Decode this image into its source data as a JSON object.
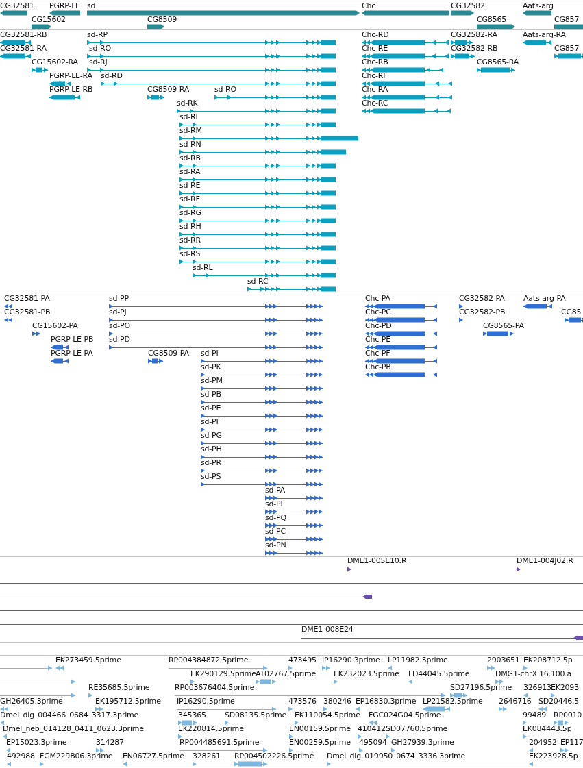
{
  "tracks": [
    {
      "kind": "gene",
      "features": [
        {
          "kind": "labeled",
          "label": "CG32581",
          "reverse": true
        },
        {
          "kind": "labeled",
          "label": "PGRP-LE",
          "reverse": true
        },
        {
          "kind": "labeled",
          "label": "sd",
          "reverse": false
        },
        {
          "kind": "labeled",
          "label": "Chc",
          "reverse": true
        },
        {
          "kind": "labeled",
          "label": "CG32582",
          "reverse": false
        },
        {
          "kind": "labeled",
          "label": "Aats-arg",
          "reverse": true
        },
        {
          "kind": "labeled",
          "label": "CG15602",
          "reverse": false
        },
        {
          "kind": "labeled",
          "label": "CG8509",
          "reverse": false
        },
        {
          "kind": "labeled",
          "label": "CG8565",
          "reverse": false
        },
        {
          "kind": "labeled",
          "label": "CG857",
          "reverse": false
        }
      ]
    },
    {
      "kind": "transcript",
      "features": [
        {
          "kind": "labeled",
          "label": "CG32581-RB",
          "reverse": true
        },
        {
          "kind": "labeled",
          "label": "sd-RP",
          "reverse": false
        },
        {
          "kind": "labeled",
          "label": "Chc-RD",
          "reverse": true
        },
        {
          "kind": "labeled",
          "label": "CG32582-RA",
          "reverse": false
        },
        {
          "kind": "labeled",
          "label": "Aats-arg-RA",
          "reverse": true
        },
        {
          "kind": "labeled",
          "label": "CG32581-RA",
          "reverse": true
        },
        {
          "kind": "labeled",
          "label": "sd-RO",
          "reverse": false
        },
        {
          "kind": "labeled",
          "label": "Chc-RE",
          "reverse": true
        },
        {
          "kind": "labeled",
          "label": "CG32582-RB",
          "reverse": false
        },
        {
          "kind": "labeled",
          "label": "CG857",
          "reverse": false
        },
        {
          "kind": "labeled",
          "label": "CG15602-RA",
          "reverse": false
        },
        {
          "kind": "labeled",
          "label": "sd-RJ",
          "reverse": false
        },
        {
          "kind": "labeled",
          "label": "Chc-RB",
          "reverse": true
        },
        {
          "kind": "labeled",
          "label": "CG8565-RA",
          "reverse": false
        },
        {
          "kind": "labeled",
          "label": "PGRP-LE-RA",
          "reverse": true
        },
        {
          "kind": "labeled",
          "label": "sd-RD",
          "reverse": false
        },
        {
          "kind": "labeled",
          "label": "Chc-RF",
          "reverse": true
        },
        {
          "kind": "labeled",
          "label": "PGRP-LE-RB",
          "reverse": true
        },
        {
          "kind": "labeled",
          "label": "CG8509-RA",
          "reverse": false
        },
        {
          "kind": "labeled",
          "label": "sd-RQ",
          "reverse": false
        },
        {
          "kind": "labeled",
          "label": "Chc-RA",
          "reverse": true
        },
        {
          "kind": "labeled",
          "label": "sd-RK",
          "reverse": false
        },
        {
          "kind": "labeled",
          "label": "Chc-RC",
          "reverse": true
        },
        {
          "kind": "labeled",
          "label": "sd-RI",
          "reverse": false
        },
        {
          "kind": "labeled",
          "label": "sd-RM",
          "reverse": false
        },
        {
          "kind": "labeled",
          "label": "sd-RN",
          "reverse": false
        },
        {
          "kind": "labeled",
          "label": "sd-RB",
          "reverse": false
        },
        {
          "kind": "labeled",
          "label": "sd-RA",
          "reverse": false
        },
        {
          "kind": "labeled",
          "label": "sd-RE",
          "reverse": false
        },
        {
          "kind": "labeled",
          "label": "sd-RF",
          "reverse": false
        },
        {
          "kind": "labeled",
          "label": "sd-RG",
          "reverse": false
        },
        {
          "kind": "labeled",
          "label": "sd-RH",
          "reverse": false
        },
        {
          "kind": "labeled",
          "label": "sd-RR",
          "reverse": false
        },
        {
          "kind": "labeled",
          "label": "sd-RS",
          "reverse": false
        },
        {
          "kind": "labeled",
          "label": "sd-RL",
          "reverse": false
        },
        {
          "kind": "labeled",
          "label": "sd-RC",
          "reverse": false
        }
      ]
    },
    {
      "kind": "protein",
      "features": [
        {
          "kind": "labeled",
          "label": "CG32581-PA",
          "reverse": true
        },
        {
          "kind": "labeled",
          "label": "sd-PP",
          "reverse": false
        },
        {
          "kind": "labeled",
          "label": "Chc-PA",
          "reverse": true
        },
        {
          "kind": "labeled",
          "label": "CG32582-PA",
          "reverse": false
        },
        {
          "kind": "labeled",
          "label": "Aats-arg-PA",
          "reverse": true
        },
        {
          "kind": "labeled",
          "label": "CG32581-PB",
          "reverse": true
        },
        {
          "kind": "labeled",
          "label": "sd-PJ",
          "reverse": false
        },
        {
          "kind": "labeled",
          "label": "Chc-PC",
          "reverse": true
        },
        {
          "kind": "labeled",
          "label": "CG32582-PB",
          "reverse": false
        },
        {
          "kind": "labeled",
          "label": "CG85",
          "reverse": false
        },
        {
          "kind": "labeled",
          "label": "CG15602-PA",
          "reverse": false
        },
        {
          "kind": "labeled",
          "label": "sd-PO",
          "reverse": false
        },
        {
          "kind": "labeled",
          "label": "Chc-PD",
          "reverse": true
        },
        {
          "kind": "labeled",
          "label": "CG8565-PA",
          "reverse": false
        },
        {
          "kind": "labeled",
          "label": "PGRP-LE-PB",
          "reverse": true
        },
        {
          "kind": "labeled",
          "label": "sd-PD",
          "reverse": false
        },
        {
          "kind": "labeled",
          "label": "Chc-PE",
          "reverse": true
        },
        {
          "kind": "labeled",
          "label": "PGRP-LE-PA",
          "reverse": true
        },
        {
          "kind": "labeled",
          "label": "CG8509-PA",
          "reverse": false
        },
        {
          "kind": "labeled",
          "label": "sd-PI",
          "reverse": false
        },
        {
          "kind": "labeled",
          "label": "Chc-PF",
          "reverse": true
        },
        {
          "kind": "labeled",
          "label": "sd-PK",
          "reverse": false
        },
        {
          "kind": "labeled",
          "label": "Chc-PB",
          "reverse": true
        },
        {
          "kind": "labeled",
          "label": "sd-PM",
          "reverse": false
        },
        {
          "kind": "labeled",
          "label": "sd-PB",
          "reverse": false
        },
        {
          "kind": "labeled",
          "label": "sd-PE",
          "reverse": false
        },
        {
          "kind": "labeled",
          "label": "sd-PF",
          "reverse": false
        },
        {
          "kind": "labeled",
          "label": "sd-PG",
          "reverse": false
        },
        {
          "kind": "labeled",
          "label": "sd-PH",
          "reverse": false
        },
        {
          "kind": "labeled",
          "label": "sd-PR",
          "reverse": false
        },
        {
          "kind": "labeled",
          "label": "sd-PS",
          "reverse": false
        },
        {
          "kind": "labeled",
          "label": "sd-PA",
          "reverse": false
        },
        {
          "kind": "labeled",
          "label": "sd-PL",
          "reverse": false
        },
        {
          "kind": "labeled",
          "label": "sd-PQ",
          "reverse": false
        },
        {
          "kind": "labeled",
          "label": "sd-PC",
          "reverse": false
        },
        {
          "kind": "labeled",
          "label": "sd-PN",
          "reverse": false
        }
      ]
    },
    {
      "kind": "alignment",
      "features": [
        {
          "kind": "labeled",
          "label": "DME1-005E10.R",
          "reverse": false
        },
        {
          "kind": "labeled",
          "label": "DME1-004J02.R",
          "reverse": false
        },
        {
          "kind": "unlabeled"
        },
        {
          "kind": "unlabeled",
          "reverse": true
        },
        {
          "kind": "unlabeled"
        },
        {
          "kind": "unlabeled"
        },
        {
          "kind": "labeled",
          "label": "DME1-008E24",
          "reverse": true
        }
      ]
    },
    {
      "kind": "est",
      "features": [
        {
          "kind": "unlabeled",
          "reverse": false
        },
        {
          "kind": "labeled",
          "label": "EK273459.5prime",
          "reverse": true
        },
        {
          "kind": "labeled",
          "label": "RP004384872.5prime",
          "reverse": false
        },
        {
          "kind": "labeled",
          "label": "473495",
          "reverse": false
        },
        {
          "kind": "labeled",
          "label": "IP16290.3prime",
          "reverse": false
        },
        {
          "kind": "labeled",
          "label": "LP11982.5prime",
          "reverse": true
        },
        {
          "kind": "labeled",
          "label": "2903651",
          "reverse": false
        },
        {
          "kind": "labeled",
          "label": "EK208712.5p",
          "reverse": false
        },
        {
          "kind": "unlabeled",
          "reverse": false
        },
        {
          "kind": "labeled",
          "label": "EK290129.5prime",
          "reverse": false
        },
        {
          "kind": "labeled",
          "label": "AT02767.5prime",
          "reverse": false
        },
        {
          "kind": "labeled",
          "label": "EK232023.5prime",
          "reverse": false
        },
        {
          "kind": "labeled",
          "label": "LD44045.5prime",
          "reverse": true
        },
        {
          "kind": "labeled",
          "label": "DMG1-chrX.16.100.a",
          "reverse": false
        },
        {
          "kind": "unlabeled",
          "reverse": false
        },
        {
          "kind": "labeled",
          "label": "RE35685.5prime",
          "reverse": false
        },
        {
          "kind": "labeled",
          "label": "RP003676404.5prime",
          "reverse": false
        },
        {
          "kind": "labeled",
          "label": "SD27196.5prime",
          "reverse": false
        },
        {
          "kind": "labeled",
          "label": "326913",
          "reverse": true
        },
        {
          "kind": "labeled",
          "label": "EK2093",
          "reverse": false
        },
        {
          "kind": "labeled",
          "label": "GH26405.3prime",
          "reverse": true
        },
        {
          "kind": "labeled",
          "label": "EK195712.5prime",
          "reverse": false
        },
        {
          "kind": "labeled",
          "label": "IP16290.5prime",
          "reverse": false
        },
        {
          "kind": "labeled",
          "label": "473576",
          "reverse": false
        },
        {
          "kind": "labeled",
          "label": "380246",
          "reverse": false
        },
        {
          "kind": "labeled",
          "label": "EP16830.3prime",
          "reverse": true
        },
        {
          "kind": "labeled",
          "label": "LP21582.5prime",
          "reverse": true
        },
        {
          "kind": "labeled",
          "label": "2646716",
          "reverse": false
        },
        {
          "kind": "labeled",
          "label": "SD20446.5",
          "reverse": true
        },
        {
          "kind": "labeled",
          "label": "Dmel_dig_004466_0684_3317.3prime",
          "reverse": true
        },
        {
          "kind": "labeled",
          "label": "345365",
          "reverse": false
        },
        {
          "kind": "labeled",
          "label": "SD08135.5prime",
          "reverse": false
        },
        {
          "kind": "labeled",
          "label": "EK110054.5prime",
          "reverse": false
        },
        {
          "kind": "labeled",
          "label": "FGC024G04.5prime",
          "reverse": true
        },
        {
          "kind": "labeled",
          "label": "99489",
          "reverse": false
        },
        {
          "kind": "labeled",
          "label": "RP0010",
          "reverse": false
        },
        {
          "kind": "labeled",
          "label": "Dmel_neb_014128_0411_0623.3prime",
          "reverse": true
        },
        {
          "kind": "labeled",
          "label": "EK220814.5prime",
          "reverse": false
        },
        {
          "kind": "labeled",
          "label": "EN00159.5prime",
          "reverse": false
        },
        {
          "kind": "labeled",
          "label": "410412",
          "reverse": false
        },
        {
          "kind": "labeled",
          "label": "SD07760.5prime",
          "reverse": false
        },
        {
          "kind": "labeled",
          "label": "EK084443.5p",
          "reverse": false
        },
        {
          "kind": "labeled",
          "label": "EP15023.3prime",
          "reverse": true
        },
        {
          "kind": "labeled",
          "label": "314287",
          "reverse": false
        },
        {
          "kind": "labeled",
          "label": "RP004485691.5prime",
          "reverse": false
        },
        {
          "kind": "labeled",
          "label": "EN00259.5prime",
          "reverse": false
        },
        {
          "kind": "labeled",
          "label": "495094",
          "reverse": false
        },
        {
          "kind": "labeled",
          "label": "GH27939.3prime",
          "reverse": false
        },
        {
          "kind": "labeled",
          "label": "204952",
          "reverse": true
        },
        {
          "kind": "labeled",
          "label": "EP117",
          "reverse": false
        },
        {
          "kind": "labeled",
          "label": "492988",
          "reverse": true
        },
        {
          "kind": "labeled",
          "label": "FGM229B06.3prime",
          "reverse": false
        },
        {
          "kind": "labeled",
          "label": "EN06727.5prime",
          "reverse": true
        },
        {
          "kind": "labeled",
          "label": "328261",
          "reverse": false
        },
        {
          "kind": "labeled",
          "label": "RP004502226.5prime",
          "reverse": false
        },
        {
          "kind": "labeled",
          "label": "Dmel_dig_019950_0674_3336.3prime",
          "reverse": false
        },
        {
          "kind": "labeled",
          "label": "EK223928.5p",
          "reverse": true
        }
      ]
    }
  ]
}
